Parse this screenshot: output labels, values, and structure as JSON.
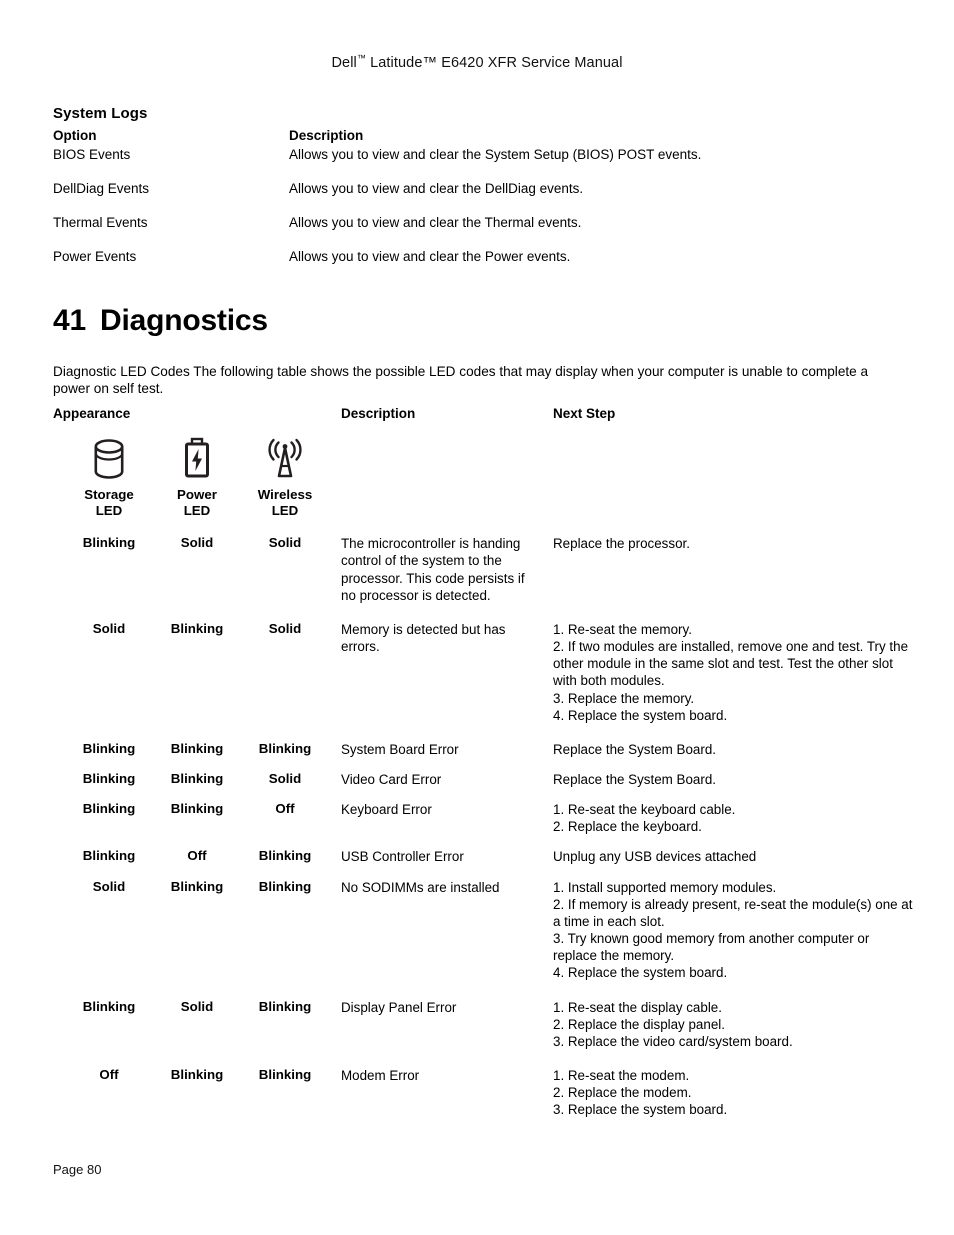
{
  "header": {
    "brand": "Dell",
    "trademark": "™",
    "title_rest": " Latitude™ E6420 XFR Service Manual",
    "full_title": "Dell™ Latitude™ E6420 XFR Service Manual"
  },
  "system_logs": {
    "title": "System Logs",
    "columns": [
      "Option",
      "Description"
    ],
    "rows": [
      {
        "option": "BIOS Events",
        "description": "Allows you to view and clear the System Setup (BIOS) POST events."
      },
      {
        "option": "DellDiag Events",
        "description": "Allows you to view and clear the DellDiag events."
      },
      {
        "option": "Thermal Events",
        "description": "Allows you to view and clear the Thermal events."
      },
      {
        "option": "Power Events",
        "description": "Allows you to view and clear the Power events."
      }
    ]
  },
  "chapter": {
    "number": "41",
    "title": "Diagnostics"
  },
  "intro": "Diagnostic LED Codes The following table shows the possible LED codes that may display when your computer is unable to complete a power on self test.",
  "led_table": {
    "columns": [
      "Appearance",
      "Description",
      "Next Step"
    ],
    "led_headers": [
      {
        "icon": "storage-drive-icon",
        "line1": "Storage",
        "line2": "LED"
      },
      {
        "icon": "battery-power-icon",
        "line1": "Power",
        "line2": "LED"
      },
      {
        "icon": "wireless-antenna-icon",
        "line1": "Wireless",
        "line2": "LED"
      }
    ],
    "rows": [
      {
        "storage": "Blinking",
        "power": "Solid",
        "wireless": "Solid",
        "description": "The microcontroller is handing control of the system to the processor. This code persists if no processor is detected.",
        "next_step": "Replace the processor."
      },
      {
        "storage": "Solid",
        "power": "Blinking",
        "wireless": "Solid",
        "description": "Memory is detected but has errors.",
        "next_step": "1. Re-seat the memory.\n2. If two modules are installed, remove one and test. Try the other module in the same slot and test. Test the other slot with both modules.\n3. Replace the memory.\n4. Replace the system board."
      },
      {
        "storage": "Blinking",
        "power": "Blinking",
        "wireless": "Blinking",
        "description": "System Board Error",
        "next_step": "Replace the System Board."
      },
      {
        "storage": "Blinking",
        "power": "Blinking",
        "wireless": "Solid",
        "description": "Video Card Error",
        "next_step": "Replace the System Board."
      },
      {
        "storage": "Blinking",
        "power": "Blinking",
        "wireless": "Off",
        "description": "Keyboard Error",
        "next_step": "1. Re-seat the keyboard cable.\n2. Replace the keyboard."
      },
      {
        "storage": "Blinking",
        "power": "Off",
        "wireless": "Blinking",
        "description": "USB Controller Error",
        "next_step": "Unplug any USB devices attached"
      },
      {
        "storage": "Solid",
        "power": "Blinking",
        "wireless": "Blinking",
        "description": "No SODIMMs are installed",
        "next_step": "1. Install supported memory modules.\n2. If memory is already present, re-seat the module(s) one at a time in each slot.\n3. Try known good memory from another computer or replace the memory.\n4. Replace the system board."
      },
      {
        "storage": "Blinking",
        "power": "Solid",
        "wireless": "Blinking",
        "description": "Display Panel Error",
        "next_step": "1. Re-seat the display cable.\n2. Replace the display panel.\n3. Replace the video card/system board."
      },
      {
        "storage": "Off",
        "power": "Blinking",
        "wireless": "Blinking",
        "description": "Modem Error",
        "next_step": "1. Re-seat the modem.\n2. Replace the modem.\n3. Replace the system board."
      }
    ]
  },
  "footer": {
    "page_label": "Page 80"
  },
  "colors": {
    "text": "#000000",
    "background": "#ffffff",
    "icon": "#231f20"
  }
}
